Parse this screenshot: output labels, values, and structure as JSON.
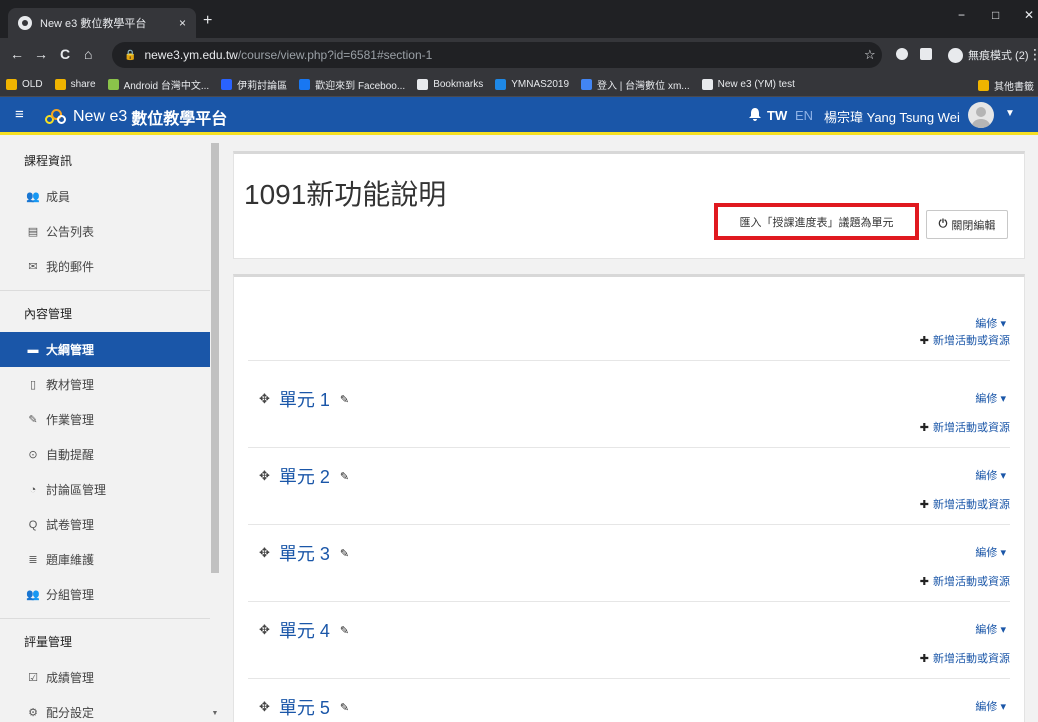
{
  "browser": {
    "tab_title": "New e3 數位教學平台",
    "tab_close": "×",
    "new_tab": "+",
    "win_min": "−",
    "win_max": "□",
    "win_close": "✕",
    "nav_back": "←",
    "nav_forward": "→",
    "nav_reload": "C",
    "nav_home": "⌂",
    "url_host": "newe3.ym.edu.tw",
    "url_path": "/course/view.php?id=6581#section-1",
    "incognito_label": "無痕模式 (2)",
    "bookmarks": [
      {
        "label": "OLD",
        "color": "#f0b400"
      },
      {
        "label": "share",
        "color": "#f0b400"
      },
      {
        "label": "Android 台灣中文...",
        "color": "#8bc34a"
      },
      {
        "label": "伊莉討論區",
        "color": "#2962ff"
      },
      {
        "label": "歡迎來到 Faceboo...",
        "color": "#1877f2"
      },
      {
        "label": "Bookmarks",
        "color": "#e8eaed"
      },
      {
        "label": "YMNAS2019",
        "color": "#1e88e5"
      },
      {
        "label": "登入 | 台灣數位 xm...",
        "color": "#4285f4"
      },
      {
        "label": "New e3 (YM) test",
        "color": "#e8eaed"
      }
    ],
    "other_bookmarks": "其他書籤"
  },
  "navbar": {
    "menu_icon": "≡",
    "brand_prefix": "New e3",
    "brand_bold": "數位教學平台",
    "bell_icon": "🔔",
    "lang_tw": "TW",
    "lang_en": "EN",
    "user_name": "楊宗瑋 Yang Tsung Wei",
    "caret": "▼"
  },
  "sidebar": {
    "sections": [
      {
        "heading": "課程資訊",
        "items": [
          {
            "label": "成員",
            "icon": "👥"
          },
          {
            "label": "公告列表",
            "icon": "▤"
          },
          {
            "label": "我的郵件",
            "icon": "✉"
          }
        ]
      },
      {
        "heading": "內容管理",
        "items": [
          {
            "label": "大綱管理",
            "icon": "▬",
            "active": true
          },
          {
            "label": "教材管理",
            "icon": "▯"
          },
          {
            "label": "作業管理",
            "icon": "✎"
          },
          {
            "label": "自動提醒",
            "icon": "⊙"
          },
          {
            "label": "討論區管理",
            "icon": "◔"
          },
          {
            "label": "試卷管理",
            "icon": "Q"
          },
          {
            "label": "題庫維護",
            "icon": "≣"
          },
          {
            "label": "分組管理",
            "icon": "👥"
          }
        ]
      },
      {
        "heading": "評量管理",
        "items": [
          {
            "label": "成績管理",
            "icon": "☑"
          },
          {
            "label": "配分設定",
            "icon": "⚙"
          }
        ]
      }
    ]
  },
  "main": {
    "title": "1091新功能說明",
    "import_button": "匯入「授課進度表」議題為單元",
    "edit_toggle_icon": "⏻",
    "edit_toggle": "關閉編輯",
    "section_edit": "編修 ▾",
    "add_activity": "新增活動或資源",
    "add_icon": "✚",
    "move_icon": "✥",
    "pencil_icon": "✎",
    "units": [
      "單元 1",
      "單元 2",
      "單元 3",
      "單元 4",
      "單元 5"
    ]
  }
}
